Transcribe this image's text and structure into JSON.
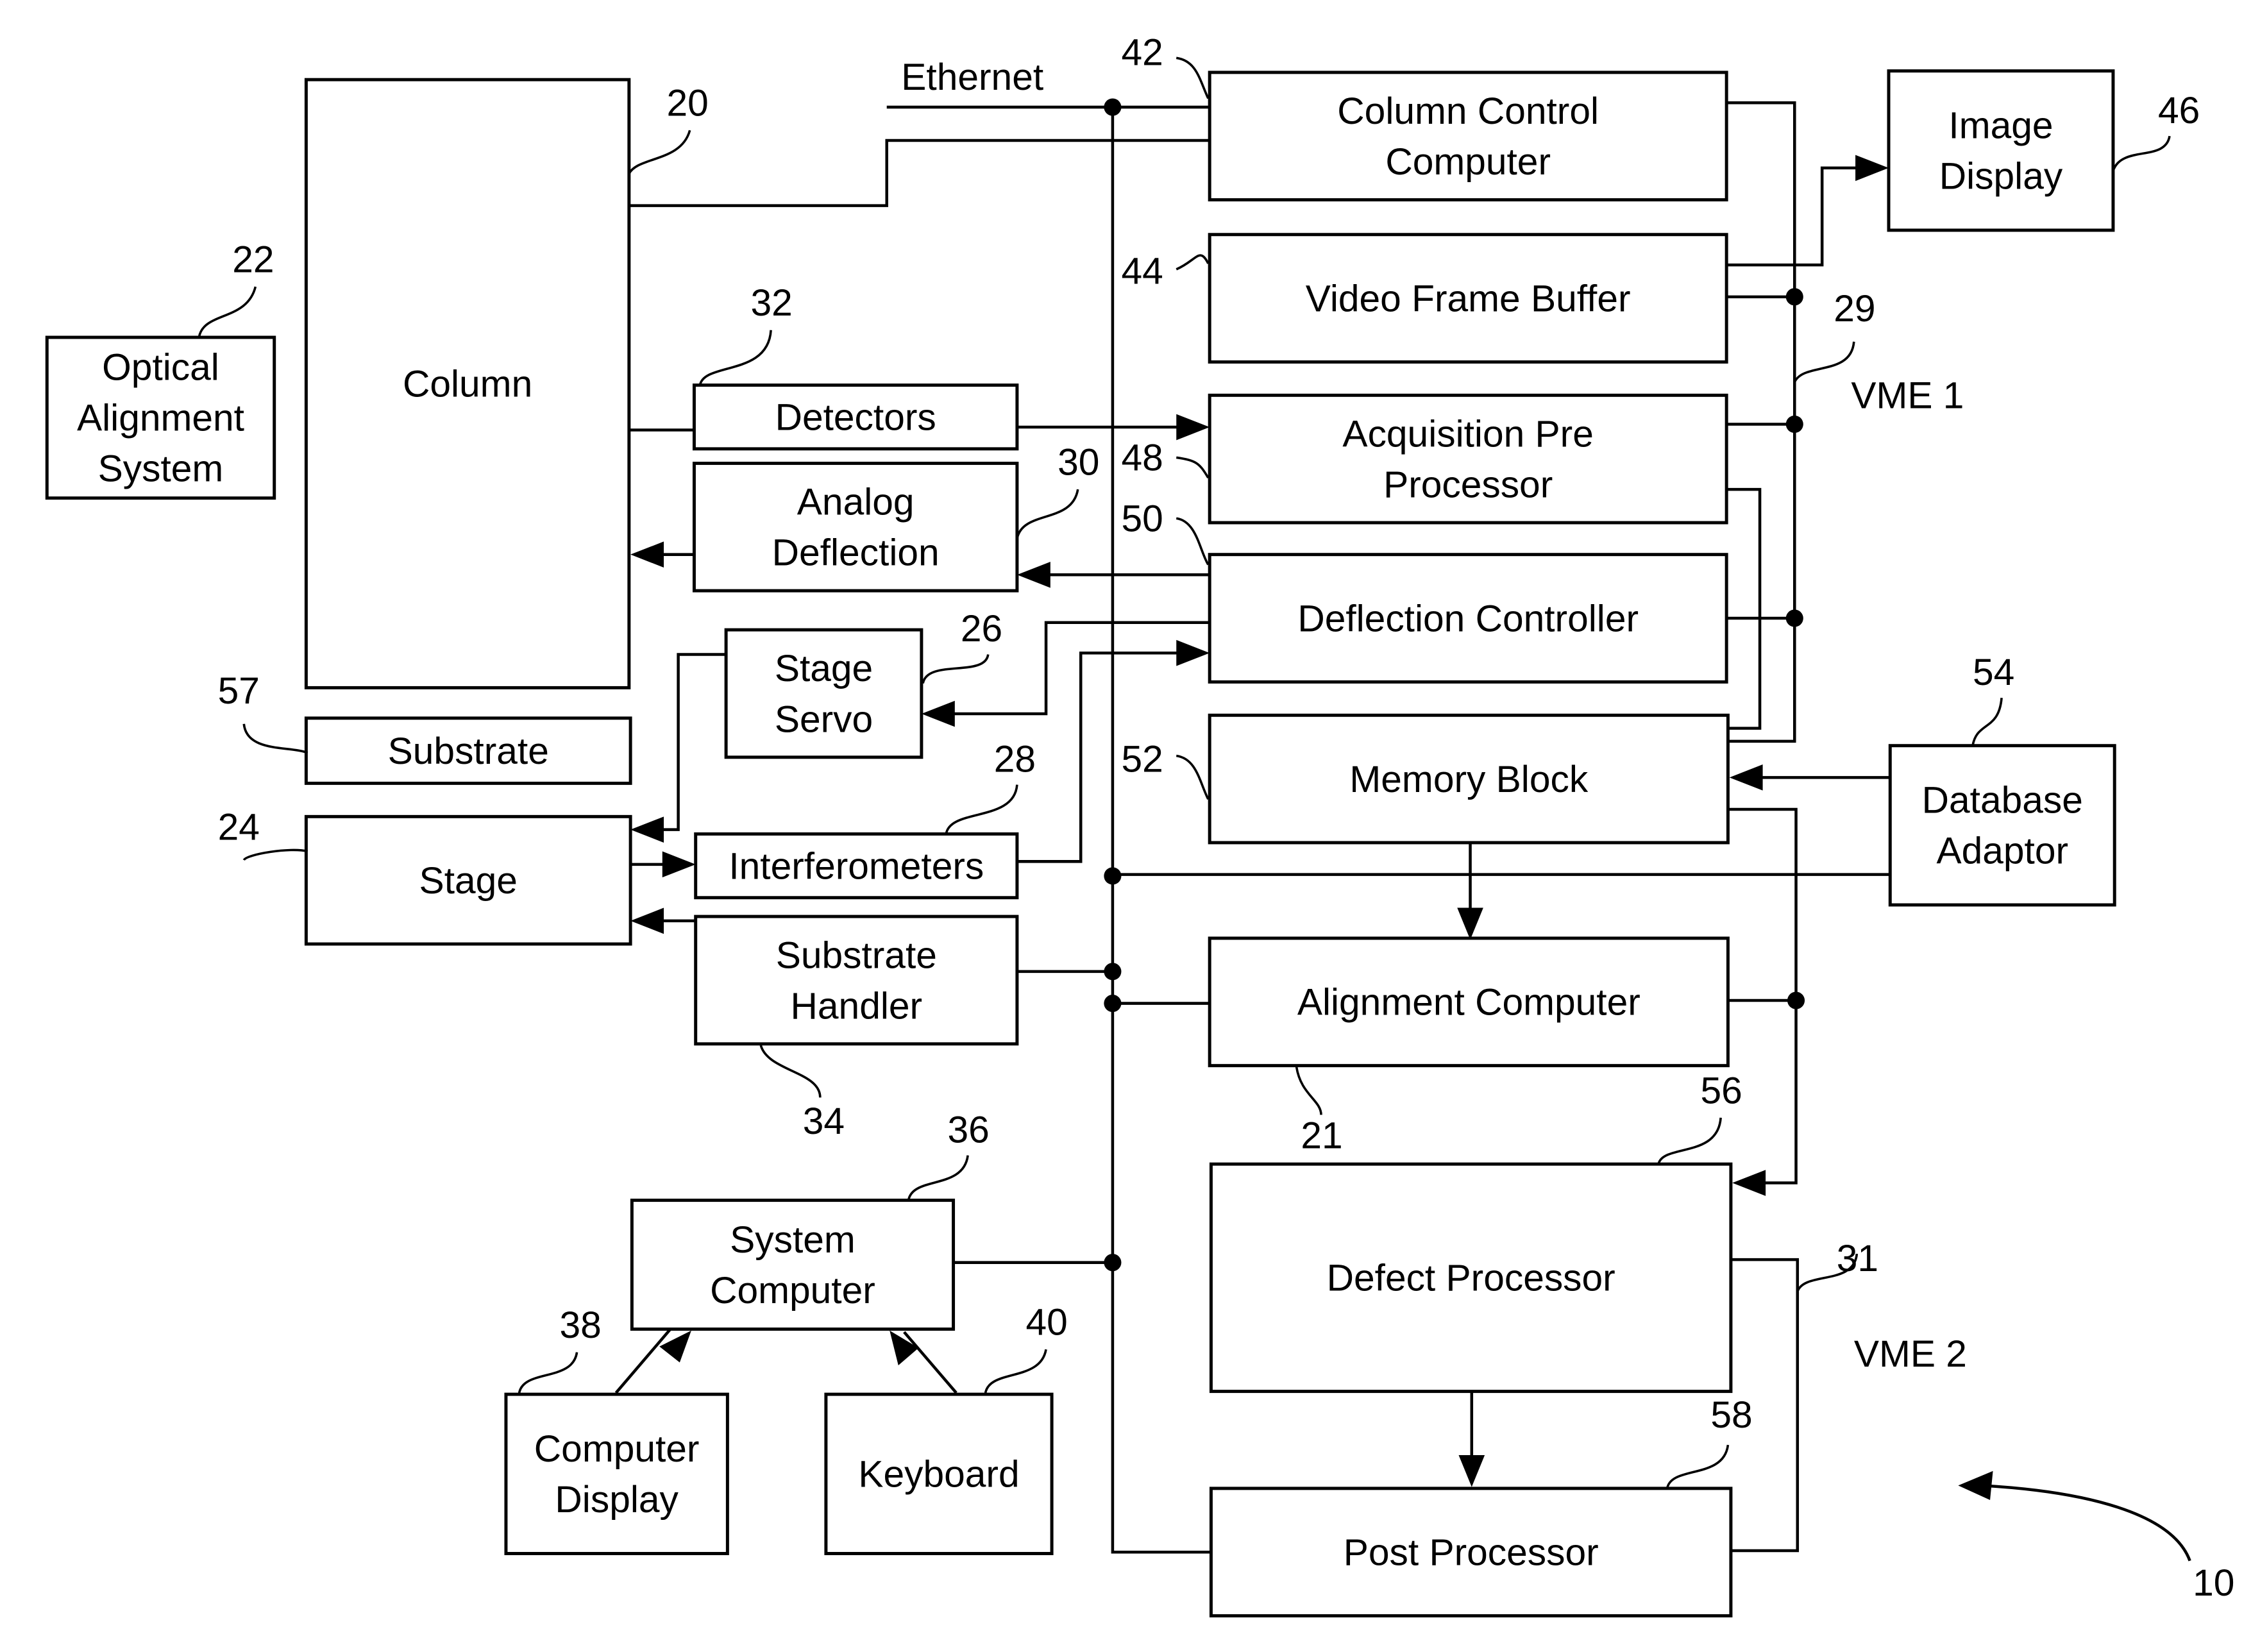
{
  "figure_ref": "10",
  "network": {
    "ethernet": "Ethernet",
    "bus1": "VME 1",
    "bus1_ref": "29",
    "bus2": "VME 2",
    "bus2_ref": "31"
  },
  "blocks": {
    "column": {
      "label": [
        "Column"
      ],
      "ref": "20"
    },
    "optical": {
      "label": [
        "Optical",
        "Alignment",
        "System"
      ],
      "ref": "22"
    },
    "detectors": {
      "label": [
        "Detectors"
      ],
      "ref": "32"
    },
    "analog": {
      "label": [
        "Analog",
        "Deflection"
      ],
      "ref": "30"
    },
    "servo": {
      "label": [
        "Stage",
        "Servo"
      ],
      "ref": "26"
    },
    "substrate": {
      "label": [
        "Substrate"
      ],
      "ref": "57"
    },
    "stage": {
      "label": [
        "Stage"
      ],
      "ref": "24"
    },
    "interf": {
      "label": [
        "Interferometers"
      ],
      "ref": "28"
    },
    "handler": {
      "label": [
        "Substrate",
        "Handler"
      ],
      "ref": "34"
    },
    "syscomp": {
      "label": [
        "System",
        "Computer"
      ],
      "ref": "36"
    },
    "compdisp": {
      "label": [
        "Computer",
        "Display"
      ],
      "ref": "38"
    },
    "keyboard": {
      "label": [
        "Keyboard"
      ],
      "ref": "40"
    },
    "ccc": {
      "label": [
        "Column Control",
        "Computer"
      ],
      "ref": "42"
    },
    "vfb": {
      "label": [
        "Video Frame Buffer"
      ],
      "ref": "44"
    },
    "imgdisp": {
      "label": [
        "Image",
        "Display"
      ],
      "ref": "46"
    },
    "acq": {
      "label": [
        "Acquisition Pre",
        "Processor"
      ],
      "ref": "48"
    },
    "defl": {
      "label": [
        "Deflection Controller"
      ],
      "ref": "50"
    },
    "mem": {
      "label": [
        "Memory Block"
      ],
      "ref": "52"
    },
    "dbadapt": {
      "label": [
        "Database",
        "Adaptor"
      ],
      "ref": "54"
    },
    "align": {
      "label": [
        "Alignment Computer"
      ],
      "ref": "21"
    },
    "defect": {
      "label": [
        "Defect Processor"
      ],
      "ref": "56"
    },
    "post": {
      "label": [
        "Post Processor"
      ],
      "ref": "58"
    }
  }
}
